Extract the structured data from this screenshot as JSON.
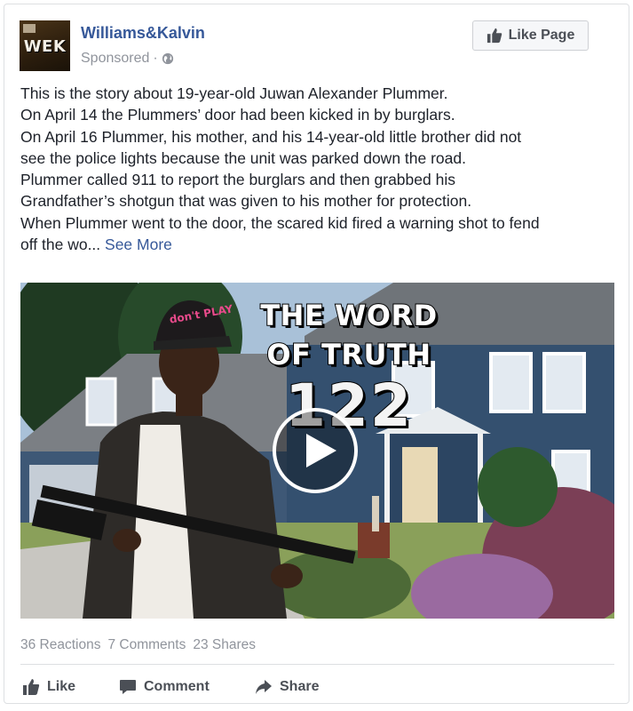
{
  "post": {
    "page_name": "Williams&Kalvin",
    "avatar_text": "WEK",
    "sponsored": "Sponsored",
    "separator": "·",
    "like_page_label": "Like Page",
    "text_lines": [
      "This is the story about 19-year-old Juwan Alexander Plummer.",
      "On April 14 the Plummers’ door had been kicked in by burglars.",
      "On April 16 Plummer, his mother, and his 14-year-old little brother did not",
      "see the police lights because the unit was parked down the road.",
      "Plummer called 911 to report the burglars and then grabbed his",
      "Grandfather’s shotgun that was given to his mother for protection.",
      "When Plummer went to the door, the scared kid fired a warning shot to fend"
    ],
    "text_last_line": "off the wo...",
    "see_more": "See More"
  },
  "video": {
    "title_line1": "THE WORD",
    "title_line2": "OF TRUTH",
    "episode": "122",
    "cap_text": "don't PLAY"
  },
  "stats": {
    "reactions": "36 Reactions",
    "comments": "7 Comments",
    "shares": "23 Shares"
  },
  "actions": {
    "like": "Like",
    "comment": "Comment",
    "share": "Share"
  },
  "colors": {
    "link": "#365899",
    "muted": "#90949c",
    "border": "#dddfe2",
    "action_text": "#4b4f56"
  },
  "icons": {
    "globe": "globe-icon",
    "thumb": "thumbs-up-icon",
    "comment": "comment-bubble-icon",
    "share": "share-arrow-icon",
    "play": "play-icon"
  }
}
